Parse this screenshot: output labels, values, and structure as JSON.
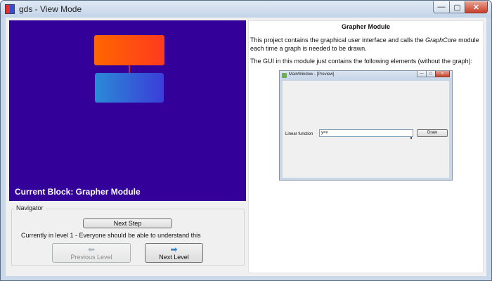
{
  "window": {
    "title": "gds - View Mode",
    "controls": {
      "minimize": "—",
      "maximize": "▢",
      "close": "✕"
    }
  },
  "diagram": {
    "current_block_label": "Current Block: Grapher Module",
    "colors": {
      "background": "#330099",
      "top_block": "#ff5500",
      "bottom_block": "#2f6fd8",
      "connector": "#cc2244"
    }
  },
  "navigator": {
    "legend": "Navigator",
    "next_step_label": "Next Step",
    "level_text": "Currently in level 1 - Everyone should be able to understand this",
    "previous_level_label": "Previous Level",
    "next_level_label": "Next Level",
    "previous_icon": "left-arrow-icon",
    "next_icon": "right-arrow-icon"
  },
  "document": {
    "title": "Grapher Module",
    "paragraph1_before": "This project contains the graphical user interface and calls the ",
    "paragraph1_emphasis": "GraphCore",
    "paragraph1_after": " module each time a graph is needed to be drawn.",
    "paragraph2": "The GUI in this module just contains the following elements (without the graph):"
  },
  "preview": {
    "title": "MainWindow - [Preview]",
    "controls": {
      "minimize": "—",
      "maximize": "▢",
      "close": "✕"
    },
    "label": "Linear function",
    "input_value": "y=x",
    "draw_button_label": "Draw"
  }
}
